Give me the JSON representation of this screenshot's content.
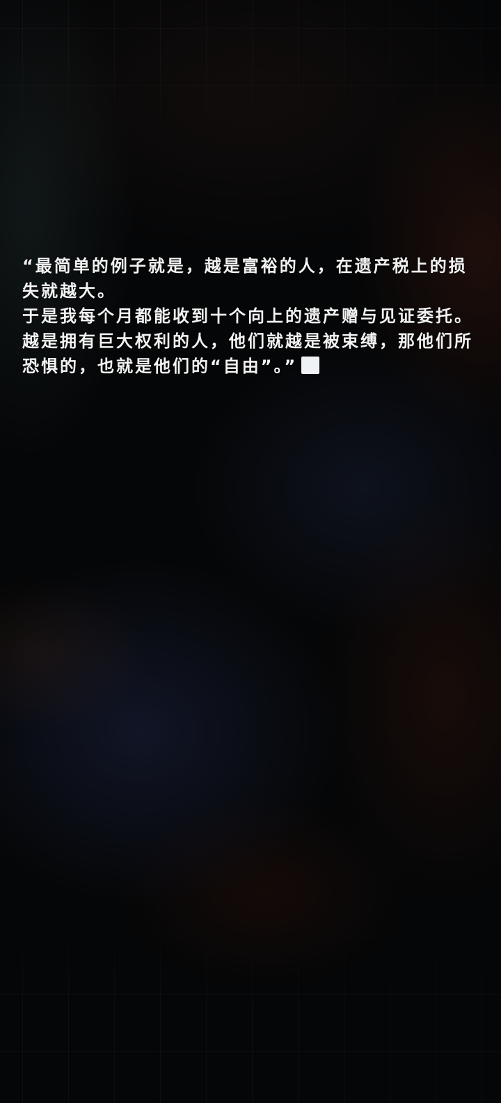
{
  "dialogue": {
    "lines": [
      "“最简单的例子就是，越是富裕的人，在遗产税上的损失就越大。",
      "于是我每个月都能收到十个向上的遗产赠与见证委托。",
      "越是拥有巨大权利的人，他们就越是被束缚，那他们所恐惧的，也就是他们的“自由”。”"
    ]
  },
  "colors": {
    "background": "#050607",
    "text": "#f2f2f2",
    "cursor": "#eef2f5"
  },
  "icons": {
    "continue_indicator": "square-cursor-icon"
  }
}
